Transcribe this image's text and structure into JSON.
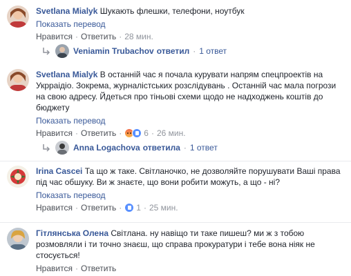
{
  "comments": [
    {
      "author": "Svetlana Mialyk",
      "text": "Шукають флешки, телефони, ноутбук",
      "translate": "Показать перевод",
      "like": "Нравится",
      "reply": "Ответить",
      "time": "28 мин."
    },
    {
      "author": "Svetlana Mialyk",
      "text": "В останній час я почала курувати напрям спецпроектів на Укрраідіо. Зокрема, журналістських розслідувань . Останній час мала погрози на свою адресу. Йдеться про тіньові схеми щодо не надходжень коштів до бюджету",
      "translate": "Показать перевод",
      "like": "Нравится",
      "reply": "Ответить",
      "reaction_count": "6",
      "time": "26 мин."
    },
    {
      "author": "Irina Cascei",
      "text": "Та що ж таке. Світланочко, не дозволяйте порушувати Ваші права під час обшуку. Ви ж знаєте, що вони робити можуть, а що - ні?",
      "translate": "Показать перевод",
      "like": "Нравится",
      "reply": "Ответить",
      "reaction_count": "1",
      "time": "25 мин."
    },
    {
      "author": "Гітлянська Олена",
      "text": "Світлана. ну навіщо ти таке пишеш? ми ж з тобою розмовляли і ти точно знаєш, що справа прокуратури і тебе вона ніяк не стосується!",
      "like": "Нравится",
      "reply": "Ответить"
    }
  ],
  "replies": [
    {
      "name": "Veniamin Trubachov",
      "verb": "ответил",
      "count": "1 ответ"
    },
    {
      "name": "Anna Logachova",
      "verb": "ответила",
      "count": "1 ответ"
    }
  ],
  "separator": "·",
  "icons": {
    "reply_arrow": "reply-arrow-icon",
    "reaction_angry": "angry-reaction-icon",
    "reaction_like": "like-reaction-icon"
  },
  "colors": {
    "link": "#385898",
    "meta": "#90949c",
    "action": "#4b4f56",
    "like_blue": "#5890ff"
  }
}
